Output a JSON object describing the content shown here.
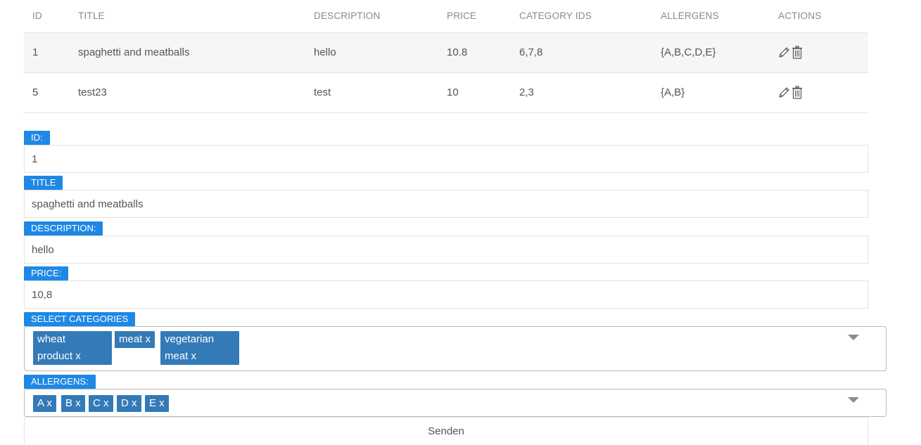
{
  "table": {
    "headers": {
      "id": "ID",
      "title": "TITLE",
      "description": "DESCRIPTION",
      "price": "PRICE",
      "category_ids": "CATEGORY IDS",
      "allergens": "ALLERGENS",
      "actions": "ACTIONS"
    },
    "rows": [
      {
        "id": "1",
        "title": "spaghetti and meatballs",
        "description": "hello",
        "price": "10.8",
        "category_ids": "6,7,8",
        "allergens": "{A,B,C,D,E}",
        "edit_icon": "pencil-icon",
        "delete_icon": "trash-icon"
      },
      {
        "id": "5",
        "title": "test23",
        "description": "test",
        "price": "10",
        "category_ids": "2,3",
        "allergens": "{A,B}",
        "edit_icon": "pencil-icon",
        "delete_icon": "trash-icon"
      }
    ]
  },
  "form": {
    "id": {
      "label": "ID:",
      "value": "1"
    },
    "title": {
      "label": "TITLE",
      "value": "spaghetti and meatballs"
    },
    "description": {
      "label": "DESCRIPTION:",
      "value": "hello"
    },
    "price": {
      "label": "PRICE:",
      "value": "10,8"
    },
    "categories": {
      "label": "SELECT CATEGORIES",
      "chips": [
        "wheat\nproduct x",
        "meat x",
        "vegetarian\nmeat x"
      ]
    },
    "allergens": {
      "label": "ALLERGENS:",
      "chips": [
        "A x",
        "B x",
        "C x",
        "D x",
        "E x"
      ]
    },
    "submit_label": "Senden"
  },
  "colors": {
    "label_bg": "#1e88e5",
    "chip_bg": "#337ab7",
    "row_stripe": "#f6f6f6"
  }
}
